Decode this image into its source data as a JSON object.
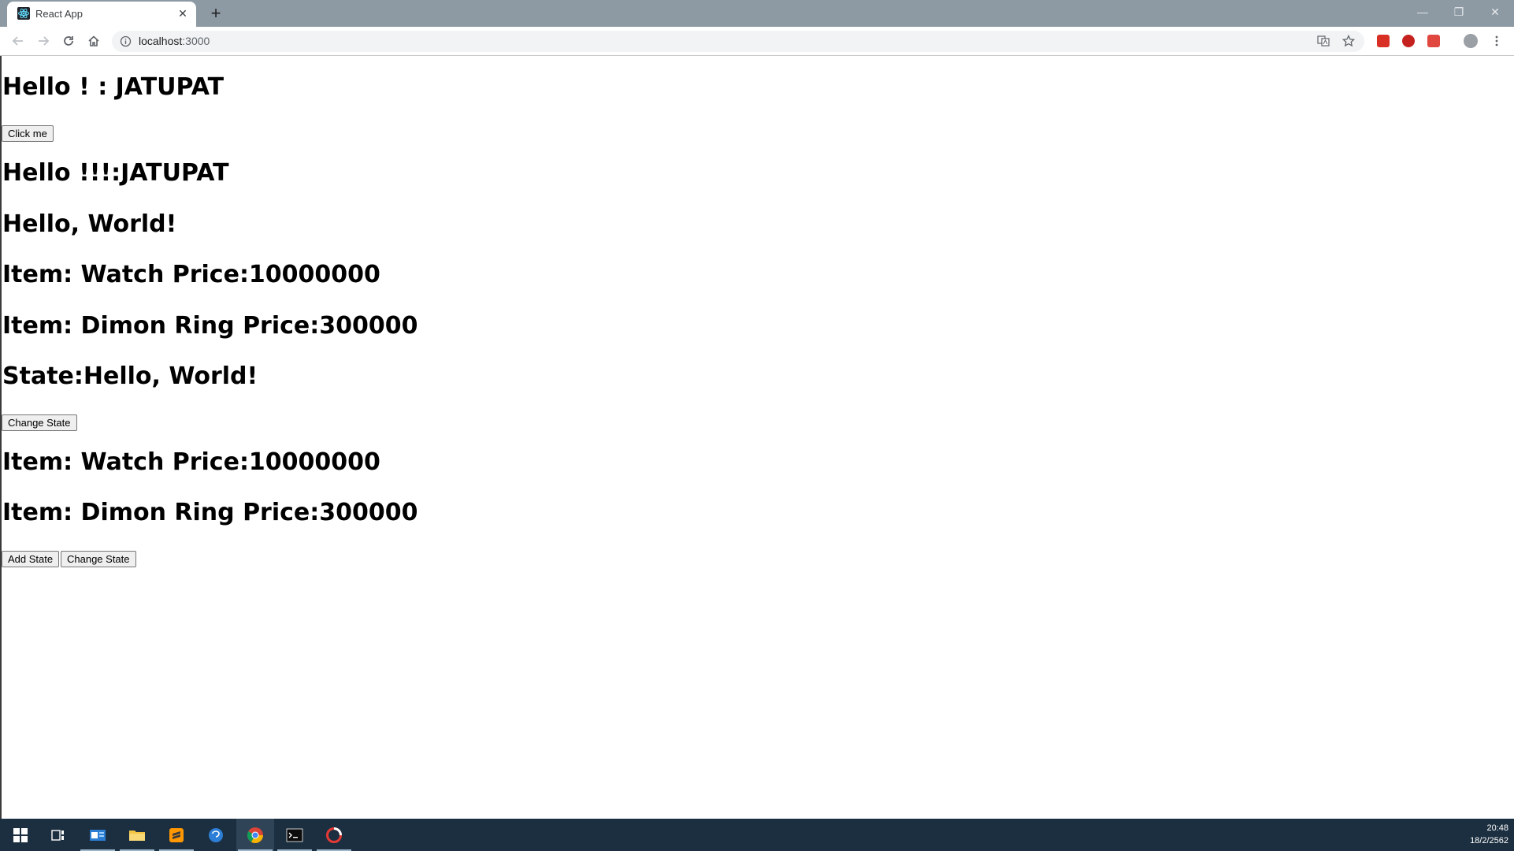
{
  "browser": {
    "tab": {
      "title": "React App",
      "close_glyph": "✕"
    },
    "new_tab_glyph": "+",
    "window_controls": {
      "minimize": "—",
      "restore": "❐",
      "close": "✕"
    },
    "address": {
      "host": "localhost",
      "port": ":3000"
    }
  },
  "page": {
    "greeting_1": "Hello ! : JATUPAT",
    "click_button": "Click me",
    "greeting_2": "Hello !!!:JATUPAT",
    "hello_world": "Hello, World!",
    "items_first": [
      {
        "text": "Item: Watch Price:10000000"
      },
      {
        "text": "Item: Dimon Ring Price:300000"
      }
    ],
    "state_heading": "State:Hello, World!",
    "change_state_button": "Change State",
    "items_second": [
      {
        "text": "Item: Watch Price:10000000"
      },
      {
        "text": "Item: Dimon Ring Price:300000"
      }
    ],
    "add_state_button": "Add State",
    "change_state_button_2": "Change State"
  },
  "taskbar": {
    "time": "20:48",
    "date": "18/2/2562"
  },
  "colors": {
    "tabstrip": "#8d9aa3",
    "taskbar": "#1c2f40",
    "chrome_blue": "#1a73e8"
  }
}
